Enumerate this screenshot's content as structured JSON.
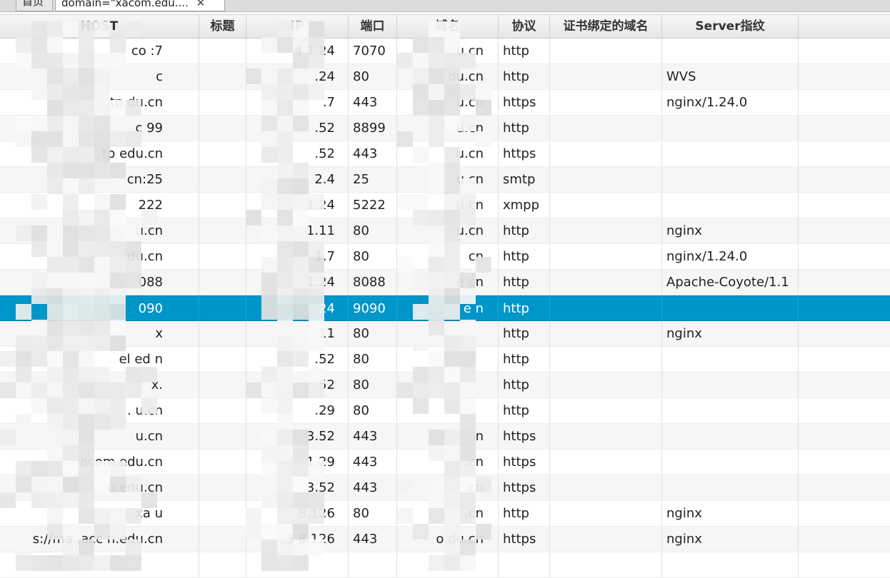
{
  "tabs": [
    {
      "label": "首页"
    },
    {
      "label": "domain=\"xacom.edu....",
      "close": "✕"
    }
  ],
  "columns": {
    "host": "HOST",
    "title": "标题",
    "ip": "IP",
    "port": "端口",
    "domain": "域名",
    "protocol": "协议",
    "cert_domain": "证书绑定的域名",
    "server": "Server指纹"
  },
  "rows": [
    {
      "host": "co          :7",
      "title": "",
      "ip": "4    1.24",
      "port": "7070",
      "domain": "      u.cn",
      "protocol": "http",
      "cert": "",
      "server": ""
    },
    {
      "host": "c",
      "title": "",
      "ip": "    .24",
      "port": "80",
      "domain": "      du.cn",
      "protocol": "http",
      "cert": "",
      "server": "WVS"
    },
    {
      "host": "tp             du.cn",
      "title": "",
      "ip": "   .7",
      "port": "443",
      "domain": "      u.cn",
      "protocol": "https",
      "cert": "",
      "server": "nginx/1.24.0"
    },
    {
      "host": "c              99",
      "title": "",
      "ip": "   .52",
      "port": "8899",
      "domain": "      u.cn",
      "protocol": "http",
      "cert": "",
      "server": ""
    },
    {
      "host": "tp           edu.cn",
      "title": "",
      "ip": "   .52",
      "port": "443",
      "domain": "      u.cn",
      "protocol": "https",
      "cert": "",
      "server": ""
    },
    {
      "host": "             cn:25",
      "title": "",
      "ip": "  2.4",
      "port": "25",
      "domain": "      u.cn",
      "protocol": "smtp",
      "cert": "",
      "server": ""
    },
    {
      "host": "          222",
      "title": "",
      "ip": "  1.24",
      "port": "5222",
      "domain": "      u.cn",
      "protocol": "xmpp",
      "cert": "",
      "server": ""
    },
    {
      "host": "          u.cn",
      "title": "",
      "ip": "  1.11",
      "port": "80",
      "domain": "      u.cn",
      "protocol": "http",
      "cert": "",
      "server": "nginx"
    },
    {
      "host": "         du.cn",
      "title": "",
      "ip": "  1.7",
      "port": "80",
      "domain": "      cn",
      "protocol": "http",
      "cert": "",
      "server": "nginx/1.24.0"
    },
    {
      "host": "         088",
      "title": "",
      "ip": "  1.24",
      "port": "8088",
      "domain": "    e   cn",
      "protocol": "http",
      "cert": "",
      "server": "Apache-Coyote/1.1"
    },
    {
      "host": "         090",
      "title": "",
      "ip": "   .24",
      "port": "9090",
      "domain": "    e   n",
      "protocol": "http",
      "cert": "",
      "server": "",
      "selected": true
    },
    {
      "host": "x",
      "title": "",
      "ip": "  .11",
      "port": "80",
      "domain": "     ",
      "protocol": "http",
      "cert": "",
      "server": "nginx"
    },
    {
      "host": "el        ed  n",
      "title": "",
      "ip": "  .52",
      "port": "80",
      "domain": "",
      "protocol": "http",
      "cert": "",
      "server": ""
    },
    {
      "host": "x.",
      "title": "",
      "ip": "  .52",
      "port": "80",
      "domain": "",
      "protocol": "http",
      "cert": "",
      "server": ""
    },
    {
      "host": ".           u.cn",
      "title": "",
      "ip": "  .29",
      "port": "80",
      "domain": "",
      "protocol": "http",
      "cert": "",
      "server": ""
    },
    {
      "host": "           u.cn",
      "title": "",
      "ip": "  3.52",
      "port": "443",
      "domain": "     n",
      "protocol": "https",
      "cert": "",
      "server": ""
    },
    {
      "host": "         acom.edu.cn",
      "title": "",
      "ip": "  1.29",
      "port": "443",
      "domain": "      .cn",
      "protocol": "https",
      "cert": "",
      "server": ""
    },
    {
      "host": "         u.edu.cn",
      "title": "",
      "ip": "  3.52",
      "port": "443",
      "domain": "      .cn",
      "protocol": "https",
      "cert": "",
      "server": ""
    },
    {
      "host": "  xa      u",
      "title": "",
      "ip": "  8.126",
      "port": "80",
      "domain": "      .cn",
      "protocol": "http",
      "cert": "",
      "server": "nginx"
    },
    {
      "host": "s://ma    .acc  n.edu.cn",
      "title": "",
      "ip": "3      8.126",
      "port": "443",
      "domain": "  o   du.cn",
      "protocol": "https",
      "cert": "",
      "server": "nginx"
    },
    {
      "host": "",
      "title": "",
      "ip": "",
      "port": "",
      "domain": "",
      "protocol": "",
      "cert": "",
      "server": ""
    }
  ]
}
